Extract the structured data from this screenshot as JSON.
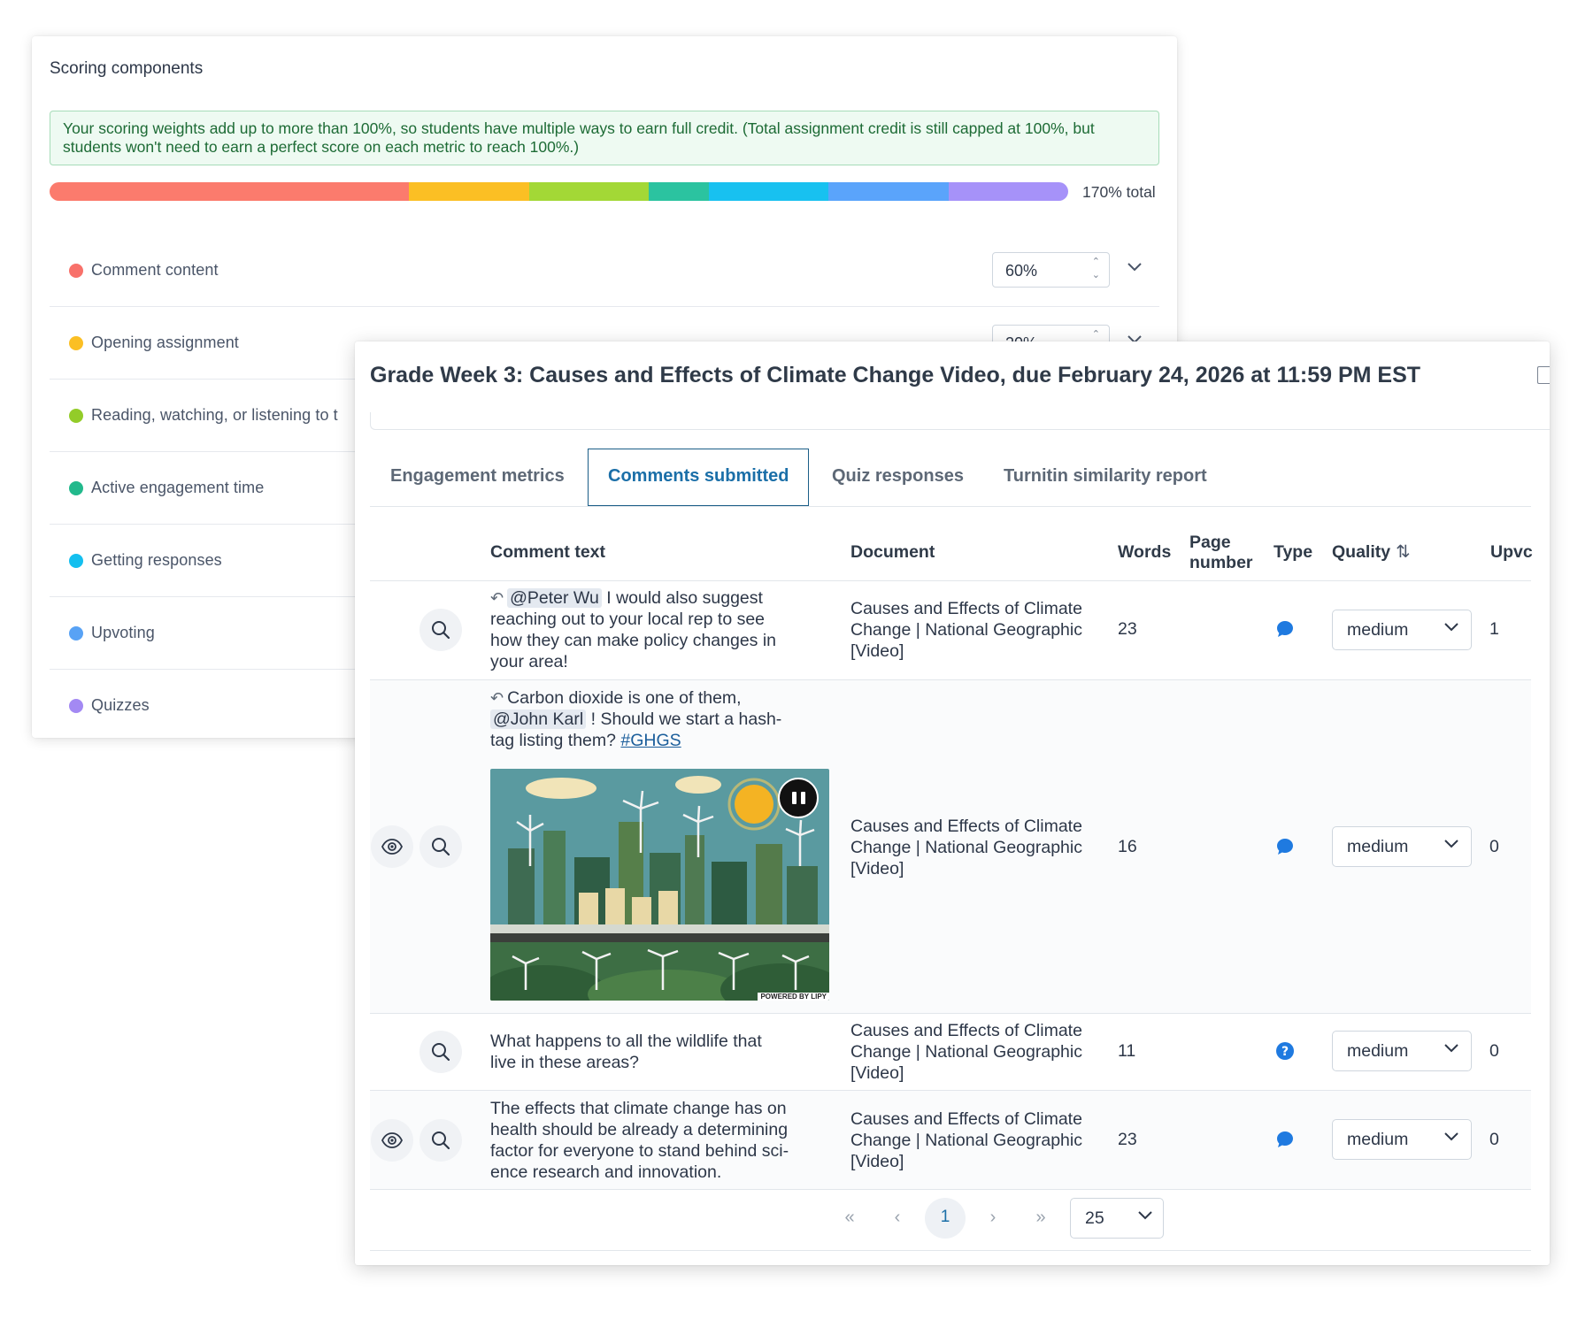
{
  "scoring": {
    "title": "Scoring components",
    "alert": "Your scoring weights add up to more than 100%, so students have multiple ways to earn full credit. (Total assignment credit is still capped at 100%, but students won't need to earn a perfect score on each metric to reach 100%.)",
    "total_label": "170% total",
    "segments": [
      {
        "color": "#fb7b6d",
        "weight": 60
      },
      {
        "color": "#fbbf24",
        "weight": 20
      },
      {
        "color": "#a3d836",
        "weight": 20
      },
      {
        "color": "#2bc3a0",
        "weight": 10
      },
      {
        "color": "#18c1f0",
        "weight": 20
      },
      {
        "color": "#5aa4fb",
        "weight": 20
      },
      {
        "color": "#a692f9",
        "weight": 20
      }
    ],
    "components": [
      {
        "label": "Comment content",
        "color": "#f8716a",
        "value": "60%"
      },
      {
        "label": "Opening assignment",
        "color": "#fbbf24",
        "value": "20%"
      },
      {
        "label": "Reading, watching, or listening to t",
        "color": "#93cc29"
      },
      {
        "label": "Active engagement time",
        "color": "#22b98c"
      },
      {
        "label": "Getting responses",
        "color": "#14bfef"
      },
      {
        "label": "Upvoting",
        "color": "#58a2f5"
      },
      {
        "label": "Quizzes",
        "color": "#a389f3"
      }
    ]
  },
  "grading": {
    "title": "Grade Week 3: Causes and Effects of Climate Change Video, due February 24, 2026 at 11:59 PM EST",
    "tabs": [
      "Engagement metrics",
      "Comments submitted",
      "Quiz responses",
      "Turnitin similarity report"
    ],
    "active_tab": 1,
    "columns": {
      "comment": "Comment text",
      "document": "Document",
      "words": "Words",
      "page_line1": "Page",
      "page_line2": "number",
      "type": "Type",
      "quality": "Quality",
      "upvotes": "Upvc"
    },
    "rows": [
      {
        "mention": "@Peter Wu",
        "text_after": " I would also suggest reaching out to your local rep to see how they can make policy changes in your area!",
        "document": "Causes and Effects of Climate Change | National Geographic [Video]",
        "words": "23",
        "type_icon": "comment-icon",
        "quality": "medium",
        "upvotes": "1"
      },
      {
        "text_before": "Carbon dioxide is one of them,",
        "mention": "@John Karl",
        "text_after": " ! Should we start a hash-tag listing them? ",
        "hashtag": "#GHGS",
        "powered_by": "POWERED BY LIPY",
        "document": "Causes and Effects of Climate Change | National Geographic [Video]",
        "words": "16",
        "type_icon": "comment-icon",
        "quality": "medium",
        "upvotes": "0"
      },
      {
        "text": "What happens to all the wildlife that live in these areas?",
        "document": "Causes and Effects of Climate Change | National Geographic [Video]",
        "words": "11",
        "type_icon": "question-icon",
        "quality": "medium",
        "upvotes": "0"
      },
      {
        "text": "The effects that climate change has on health should be already a determining factor for everyone to stand behind sci-ence research and innovation.",
        "document": "Causes and Effects of Climate Change | National Geographic [Video]",
        "words": "23",
        "type_icon": "comment-icon",
        "quality": "medium",
        "upvotes": "0"
      }
    ],
    "pagination": {
      "first": "«",
      "prev": "‹",
      "current": "1",
      "next": "›",
      "last": "»",
      "page_size": "25"
    }
  }
}
